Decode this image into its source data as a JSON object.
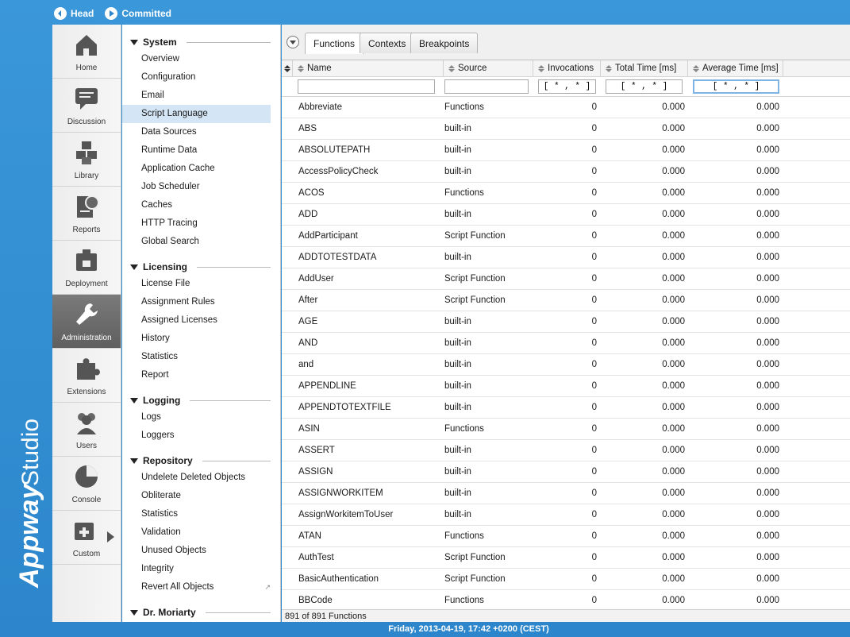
{
  "topbar": {
    "head_label": "Head",
    "committed_label": "Committed"
  },
  "brand": {
    "name": "Appway",
    "product": "Studio"
  },
  "iconbar": [
    {
      "label": "Home",
      "icon": "home-icon"
    },
    {
      "label": "Discussion",
      "icon": "discussion-icon"
    },
    {
      "label": "Library",
      "icon": "library-icon"
    },
    {
      "label": "Reports",
      "icon": "reports-icon"
    },
    {
      "label": "Deployment",
      "icon": "deployment-icon"
    },
    {
      "label": "Administration",
      "icon": "wrench-icon",
      "active": true
    },
    {
      "label": "Extensions",
      "icon": "puzzle-icon"
    },
    {
      "label": "Users",
      "icon": "users-icon"
    },
    {
      "label": "Console",
      "icon": "pie-icon"
    },
    {
      "label": "Custom",
      "icon": "custom-icon"
    }
  ],
  "nav": {
    "groups": [
      {
        "title": "System",
        "items": [
          "Overview",
          "Configuration",
          "Email",
          "Script Language",
          "Data Sources",
          "Runtime Data",
          "Application Cache",
          "Job Scheduler",
          "Caches",
          "HTTP Tracing",
          "Global Search"
        ],
        "selected": "Script Language"
      },
      {
        "title": "Licensing",
        "items": [
          "License File",
          "Assignment Rules",
          "Assigned Licenses",
          "History",
          "Statistics",
          "Report"
        ]
      },
      {
        "title": "Logging",
        "items": [
          "Logs",
          "Loggers"
        ]
      },
      {
        "title": "Repository",
        "items": [
          "Undelete Deleted Objects",
          "Obliterate",
          "Statistics",
          "Validation",
          "Unused Objects",
          "Integrity",
          "Revert All Objects"
        ]
      },
      {
        "title": "Dr. Moriarty",
        "items": []
      }
    ]
  },
  "tabs": [
    "Functions",
    "Contexts",
    "Breakpoints"
  ],
  "active_tab": "Functions",
  "table": {
    "headers": {
      "name": "Name",
      "source": "Source",
      "invocations": "Invocations",
      "total": "Total Time [ms]",
      "average": "Average Time [ms]"
    },
    "filters": {
      "name": "",
      "source": "",
      "invocations": "[ * , * ]",
      "total": "[ * , * ]",
      "average": "[ * , * ]"
    },
    "rows": [
      [
        "Abbreviate",
        "Functions",
        "0",
        "0.000",
        "0.000"
      ],
      [
        "ABS",
        "built-in",
        "0",
        "0.000",
        "0.000"
      ],
      [
        "ABSOLUTEPATH",
        "built-in",
        "0",
        "0.000",
        "0.000"
      ],
      [
        "AccessPolicyCheck",
        "built-in",
        "0",
        "0.000",
        "0.000"
      ],
      [
        "ACOS",
        "Functions",
        "0",
        "0.000",
        "0.000"
      ],
      [
        "ADD",
        "built-in",
        "0",
        "0.000",
        "0.000"
      ],
      [
        "AddParticipant",
        "Script Function",
        "0",
        "0.000",
        "0.000"
      ],
      [
        "ADDTOTESTDATA",
        "built-in",
        "0",
        "0.000",
        "0.000"
      ],
      [
        "AddUser",
        "Script Function",
        "0",
        "0.000",
        "0.000"
      ],
      [
        "After",
        "Script Function",
        "0",
        "0.000",
        "0.000"
      ],
      [
        "AGE",
        "built-in",
        "0",
        "0.000",
        "0.000"
      ],
      [
        "AND",
        "built-in",
        "0",
        "0.000",
        "0.000"
      ],
      [
        "and",
        "built-in",
        "0",
        "0.000",
        "0.000"
      ],
      [
        "APPENDLINE",
        "built-in",
        "0",
        "0.000",
        "0.000"
      ],
      [
        "APPENDTOTEXTFILE",
        "built-in",
        "0",
        "0.000",
        "0.000"
      ],
      [
        "ASIN",
        "Functions",
        "0",
        "0.000",
        "0.000"
      ],
      [
        "ASSERT",
        "built-in",
        "0",
        "0.000",
        "0.000"
      ],
      [
        "ASSIGN",
        "built-in",
        "0",
        "0.000",
        "0.000"
      ],
      [
        "ASSIGNWORKITEM",
        "built-in",
        "0",
        "0.000",
        "0.000"
      ],
      [
        "AssignWorkitemToUser",
        "built-in",
        "0",
        "0.000",
        "0.000"
      ],
      [
        "ATAN",
        "Functions",
        "0",
        "0.000",
        "0.000"
      ],
      [
        "AuthTest",
        "Script Function",
        "0",
        "0.000",
        "0.000"
      ],
      [
        "BasicAuthentication",
        "Script Function",
        "0",
        "0.000",
        "0.000"
      ],
      [
        "BBCode",
        "Functions",
        "0",
        "0.000",
        "0.000"
      ]
    ]
  },
  "footer": "891 of 891 Functions",
  "status": "Friday, 2013-04-19, 17:42 +0200 (CEST)"
}
